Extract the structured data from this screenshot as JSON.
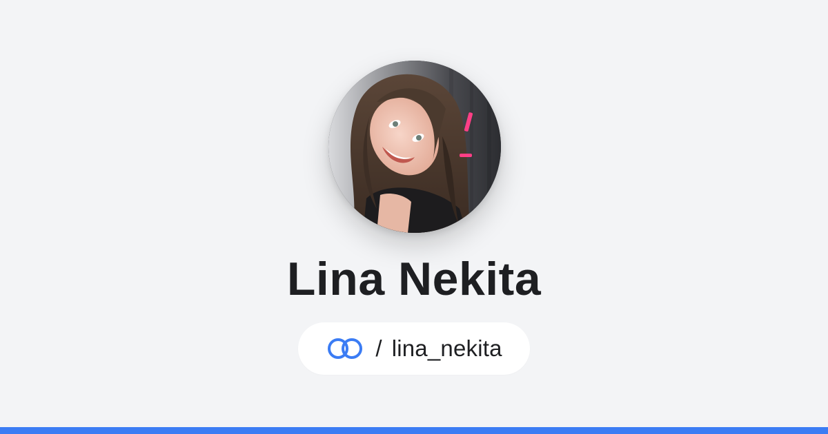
{
  "profile": {
    "name": "Lina Nekita",
    "handle_separator": "/",
    "handle": "lina_nekita",
    "avatar_alt": "Lina Nekita profile photo"
  },
  "icons": {
    "link": "link-rings-icon"
  },
  "colors": {
    "background": "#f3f4f6",
    "accent": "#3b7cf4",
    "text": "#1e1f22",
    "pill": "#ffffff"
  }
}
